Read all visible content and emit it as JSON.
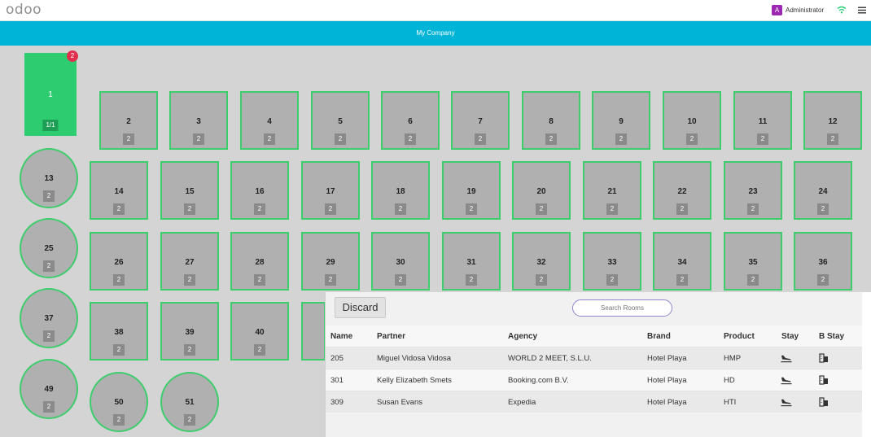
{
  "header": {
    "logo": "odoo",
    "user_initial": "A",
    "user_name": "Administrator",
    "company": "My Company"
  },
  "floor": {
    "tables": [
      {
        "id": "1",
        "seats": "1/1",
        "shape": "square",
        "active": true,
        "notification": "2"
      },
      {
        "id": "2",
        "seats": "2",
        "shape": "square"
      },
      {
        "id": "3",
        "seats": "2",
        "shape": "square"
      },
      {
        "id": "4",
        "seats": "2",
        "shape": "square"
      },
      {
        "id": "5",
        "seats": "2",
        "shape": "square"
      },
      {
        "id": "6",
        "seats": "2",
        "shape": "square"
      },
      {
        "id": "7",
        "seats": "2",
        "shape": "square"
      },
      {
        "id": "8",
        "seats": "2",
        "shape": "square"
      },
      {
        "id": "9",
        "seats": "2",
        "shape": "square"
      },
      {
        "id": "10",
        "seats": "2",
        "shape": "square"
      },
      {
        "id": "11",
        "seats": "2",
        "shape": "square"
      },
      {
        "id": "12",
        "seats": "2",
        "shape": "square"
      },
      {
        "id": "13",
        "seats": "2",
        "shape": "round"
      },
      {
        "id": "14",
        "seats": "2",
        "shape": "square"
      },
      {
        "id": "15",
        "seats": "2",
        "shape": "square"
      },
      {
        "id": "16",
        "seats": "2",
        "shape": "square"
      },
      {
        "id": "17",
        "seats": "2",
        "shape": "square"
      },
      {
        "id": "18",
        "seats": "2",
        "shape": "square"
      },
      {
        "id": "19",
        "seats": "2",
        "shape": "square"
      },
      {
        "id": "20",
        "seats": "2",
        "shape": "square"
      },
      {
        "id": "21",
        "seats": "2",
        "shape": "square"
      },
      {
        "id": "22",
        "seats": "2",
        "shape": "square"
      },
      {
        "id": "23",
        "seats": "2",
        "shape": "square"
      },
      {
        "id": "24",
        "seats": "2",
        "shape": "square"
      },
      {
        "id": "25",
        "seats": "2",
        "shape": "round"
      },
      {
        "id": "26",
        "seats": "2",
        "shape": "square"
      },
      {
        "id": "27",
        "seats": "2",
        "shape": "square"
      },
      {
        "id": "28",
        "seats": "2",
        "shape": "square"
      },
      {
        "id": "29",
        "seats": "2",
        "shape": "square"
      },
      {
        "id": "30",
        "seats": "2",
        "shape": "square"
      },
      {
        "id": "31",
        "seats": "2",
        "shape": "square"
      },
      {
        "id": "32",
        "seats": "2",
        "shape": "square"
      },
      {
        "id": "33",
        "seats": "2",
        "shape": "square"
      },
      {
        "id": "34",
        "seats": "2",
        "shape": "square"
      },
      {
        "id": "35",
        "seats": "2",
        "shape": "square"
      },
      {
        "id": "36",
        "seats": "2",
        "shape": "square"
      },
      {
        "id": "37",
        "seats": "2",
        "shape": "round"
      },
      {
        "id": "38",
        "seats": "2",
        "shape": "square"
      },
      {
        "id": "39",
        "seats": "2",
        "shape": "square"
      },
      {
        "id": "40",
        "seats": "2",
        "shape": "square"
      },
      {
        "id": "",
        "seats": "",
        "shape": "square"
      },
      {
        "id": "49",
        "seats": "2",
        "shape": "round"
      },
      {
        "id": "50",
        "seats": "2",
        "shape": "round"
      },
      {
        "id": "51",
        "seats": "2",
        "shape": "round"
      }
    ]
  },
  "panel": {
    "discard_label": "Discard",
    "search_placeholder": "Search Rooms",
    "columns": [
      "Name",
      "Partner",
      "Agency",
      "Brand",
      "Product",
      "Stay",
      "B Stay"
    ],
    "rows": [
      {
        "name": "205",
        "partner": "Miguel Vidosa Vidosa",
        "agency": "WORLD 2 MEET, S.L.U.",
        "brand": "Hotel Playa",
        "product": "HMP",
        "stay_icon": "plane-landing-icon",
        "bstay_icon": "building-icon"
      },
      {
        "name": "301",
        "partner": "Kelly Elizabeth Smets",
        "agency": "Booking.com B.V.",
        "brand": "Hotel Playa",
        "product": "HD",
        "stay_icon": "plane-landing-icon",
        "bstay_icon": "building-icon"
      },
      {
        "name": "309",
        "partner": "Susan Evans",
        "agency": "Expedia",
        "brand": "Hotel Playa",
        "product": "HTI",
        "stay_icon": "plane-landing-icon",
        "bstay_icon": "building-icon"
      }
    ]
  },
  "colors": {
    "company_bar": "#00b4d8",
    "table_border": "#3dcd6c",
    "active_table": "#2ecc71",
    "notification": "#e0304e",
    "avatar": "#9c27b0"
  }
}
